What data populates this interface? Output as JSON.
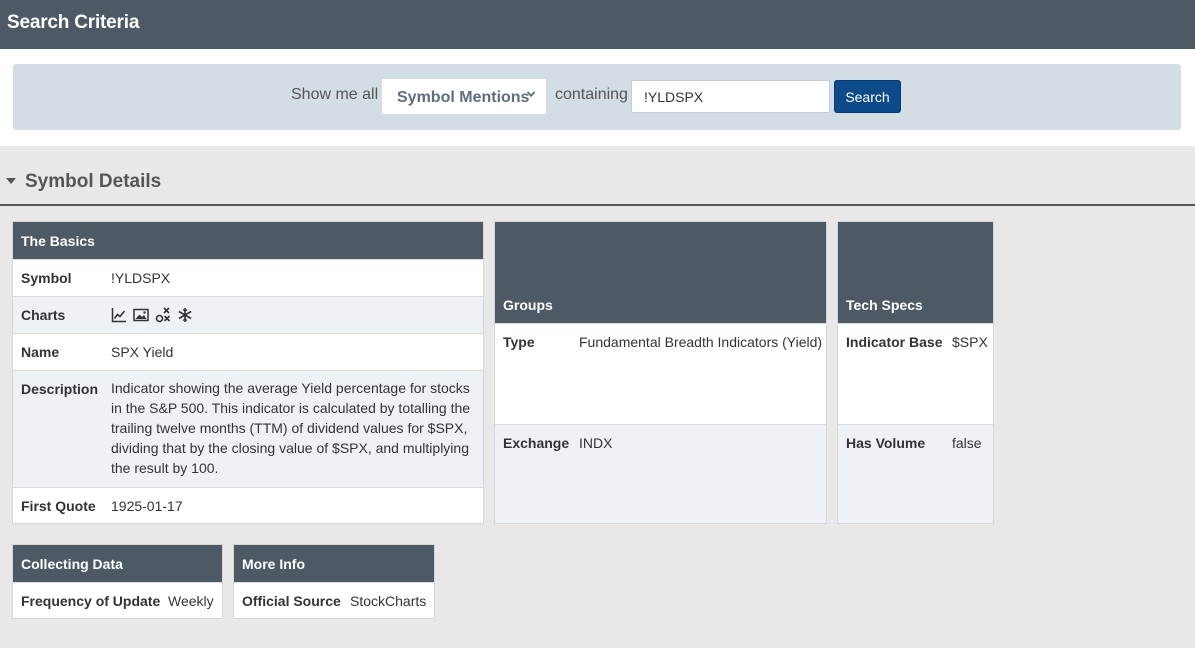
{
  "header": {
    "title": "Search Criteria"
  },
  "search": {
    "show_me_label": "Show me all",
    "select_value": "Symbol Mentions",
    "containing_label": "containing",
    "query": "!YLDSPX",
    "button_label": "Search"
  },
  "section": {
    "title": "Symbol Details"
  },
  "basics": {
    "title": "The Basics",
    "symbol_label": "Symbol",
    "symbol_value": "!YLDSPX",
    "charts_label": "Charts",
    "chart_icons": [
      "line-chart-icon",
      "image-chart-icon",
      "pnf-chart-icon",
      "seasonality-chart-icon"
    ],
    "name_label": "Name",
    "name_value": "SPX Yield",
    "description_label": "Description",
    "description_value": "Indicator showing the average Yield percentage for stocks in the S&P 500. This indicator is calculated by totalling the trailing twelve months (TTM) of dividend values for $SPX, dividing that by the closing value of $SPX, and multiplying the result by 100.",
    "first_quote_label": "First Quote",
    "first_quote_value": "1925-01-17"
  },
  "groups": {
    "title": "Groups",
    "type_label": "Type",
    "type_value": "Fundamental Breadth Indicators (Yield)",
    "exchange_label": "Exchange",
    "exchange_value": "INDX"
  },
  "tech_specs": {
    "title": "Tech Specs",
    "indicator_base_label": "Indicator Base",
    "indicator_base_value": "$SPX",
    "has_volume_label": "Has Volume",
    "has_volume_value": "false"
  },
  "collecting": {
    "title": "Collecting Data",
    "frequency_label": "Frequency of Update",
    "frequency_value": "Weekly"
  },
  "more_info": {
    "title": "More Info",
    "source_label": "Official Source",
    "source_value": "StockCharts"
  }
}
